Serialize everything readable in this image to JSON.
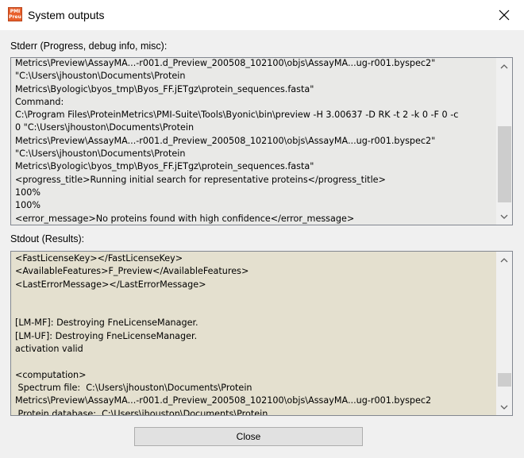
{
  "window": {
    "title": "System outputs",
    "app_icon_text": [
      "PMI",
      "Preu"
    ]
  },
  "stderr": {
    "label": "Stderr (Progress, debug info, misc):",
    "lines": [
      "Metrics\\Preview\\AssayMA...-r001.d_Preview_200508_102100\\objs\\AssayMA...ug-r001.byspec2\"",
      "\"C:\\Users\\jhouston\\Documents\\Protein",
      "Metrics\\Byologic\\byos_tmp\\Byos_FF.jETgz\\protein_sequences.fasta\"",
      "Command:",
      "C:\\Program Files\\ProteinMetrics\\PMI-Suite\\Tools\\Byonic\\bin\\preview -H 3.00637 -D RK -t 2 -k 0 -F 0 -c",
      "0 \"C:\\Users\\jhouston\\Documents\\Protein",
      "Metrics\\Preview\\AssayMA...-r001.d_Preview_200508_102100\\objs\\AssayMA...ug-r001.byspec2\"",
      "\"C:\\Users\\jhouston\\Documents\\Protein",
      "Metrics\\Byologic\\byos_tmp\\Byos_FF.jETgz\\protein_sequences.fasta\"",
      "<progress_title>Running initial search for representative proteins</progress_title>",
      "100%",
      "100%",
      "<error_message>No proteins found with high confidence</error_message>"
    ]
  },
  "stdout": {
    "label": "Stdout (Results):",
    "lines": [
      "<FastLicenseKey></FastLicenseKey>",
      "<AvailableFeatures>F_Preview</AvailableFeatures>",
      "<LastErrorMessage></LastErrorMessage>",
      "",
      "",
      "[LM-MF]: Destroying FneLicenseManager.",
      "[LM-UF]: Destroying FneLicenseManager.",
      "activation valid",
      "",
      "<computation>",
      " Spectrum file:  C:\\Users\\jhouston\\Documents\\Protein",
      "Metrics\\Preview\\AssayMA...-r001.d_Preview_200508_102100\\objs\\AssayMA...ug-r001.byspec2",
      " Protein database:  C:\\Users\\jhouston\\Documents\\Protein"
    ]
  },
  "buttons": {
    "close_label": "Close"
  },
  "colors": {
    "stderr_background": "#e9e9e7",
    "stdout_background": "#e4e0cf",
    "scrollbar_thumb": "#cdcdcd",
    "app_icon": "#e8602c"
  },
  "icons": {
    "close": "close-icon",
    "scroll_up": "chevron-up-icon",
    "scroll_down": "chevron-down-icon"
  }
}
